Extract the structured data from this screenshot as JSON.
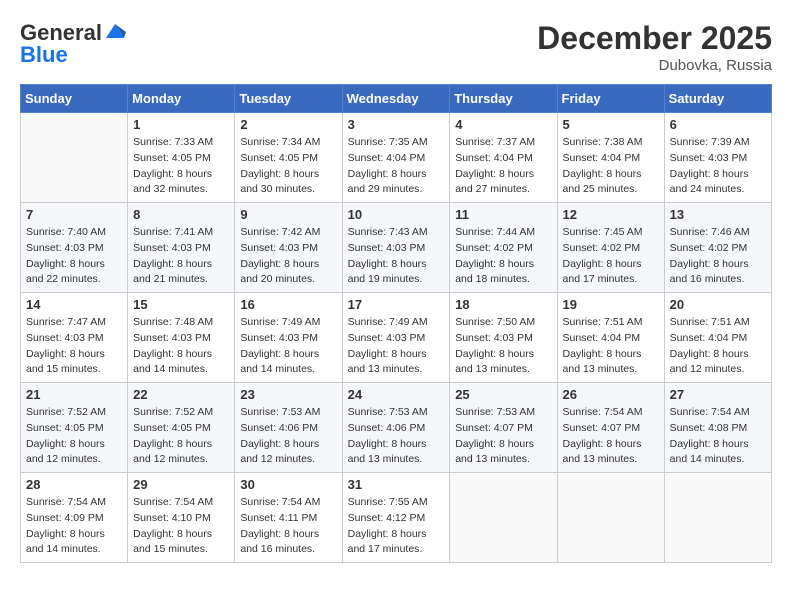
{
  "header": {
    "logo_line1": "General",
    "logo_line2": "Blue",
    "month": "December 2025",
    "location": "Dubovka, Russia"
  },
  "days_of_week": [
    "Sunday",
    "Monday",
    "Tuesday",
    "Wednesday",
    "Thursday",
    "Friday",
    "Saturday"
  ],
  "weeks": [
    [
      {
        "day": "",
        "sunrise": "",
        "sunset": "",
        "daylight": ""
      },
      {
        "day": "1",
        "sunrise": "Sunrise: 7:33 AM",
        "sunset": "Sunset: 4:05 PM",
        "daylight": "Daylight: 8 hours and 32 minutes."
      },
      {
        "day": "2",
        "sunrise": "Sunrise: 7:34 AM",
        "sunset": "Sunset: 4:05 PM",
        "daylight": "Daylight: 8 hours and 30 minutes."
      },
      {
        "day": "3",
        "sunrise": "Sunrise: 7:35 AM",
        "sunset": "Sunset: 4:04 PM",
        "daylight": "Daylight: 8 hours and 29 minutes."
      },
      {
        "day": "4",
        "sunrise": "Sunrise: 7:37 AM",
        "sunset": "Sunset: 4:04 PM",
        "daylight": "Daylight: 8 hours and 27 minutes."
      },
      {
        "day": "5",
        "sunrise": "Sunrise: 7:38 AM",
        "sunset": "Sunset: 4:04 PM",
        "daylight": "Daylight: 8 hours and 25 minutes."
      },
      {
        "day": "6",
        "sunrise": "Sunrise: 7:39 AM",
        "sunset": "Sunset: 4:03 PM",
        "daylight": "Daylight: 8 hours and 24 minutes."
      }
    ],
    [
      {
        "day": "7",
        "sunrise": "Sunrise: 7:40 AM",
        "sunset": "Sunset: 4:03 PM",
        "daylight": "Daylight: 8 hours and 22 minutes."
      },
      {
        "day": "8",
        "sunrise": "Sunrise: 7:41 AM",
        "sunset": "Sunset: 4:03 PM",
        "daylight": "Daylight: 8 hours and 21 minutes."
      },
      {
        "day": "9",
        "sunrise": "Sunrise: 7:42 AM",
        "sunset": "Sunset: 4:03 PM",
        "daylight": "Daylight: 8 hours and 20 minutes."
      },
      {
        "day": "10",
        "sunrise": "Sunrise: 7:43 AM",
        "sunset": "Sunset: 4:03 PM",
        "daylight": "Daylight: 8 hours and 19 minutes."
      },
      {
        "day": "11",
        "sunrise": "Sunrise: 7:44 AM",
        "sunset": "Sunset: 4:02 PM",
        "daylight": "Daylight: 8 hours and 18 minutes."
      },
      {
        "day": "12",
        "sunrise": "Sunrise: 7:45 AM",
        "sunset": "Sunset: 4:02 PM",
        "daylight": "Daylight: 8 hours and 17 minutes."
      },
      {
        "day": "13",
        "sunrise": "Sunrise: 7:46 AM",
        "sunset": "Sunset: 4:02 PM",
        "daylight": "Daylight: 8 hours and 16 minutes."
      }
    ],
    [
      {
        "day": "14",
        "sunrise": "Sunrise: 7:47 AM",
        "sunset": "Sunset: 4:03 PM",
        "daylight": "Daylight: 8 hours and 15 minutes."
      },
      {
        "day": "15",
        "sunrise": "Sunrise: 7:48 AM",
        "sunset": "Sunset: 4:03 PM",
        "daylight": "Daylight: 8 hours and 14 minutes."
      },
      {
        "day": "16",
        "sunrise": "Sunrise: 7:49 AM",
        "sunset": "Sunset: 4:03 PM",
        "daylight": "Daylight: 8 hours and 14 minutes."
      },
      {
        "day": "17",
        "sunrise": "Sunrise: 7:49 AM",
        "sunset": "Sunset: 4:03 PM",
        "daylight": "Daylight: 8 hours and 13 minutes."
      },
      {
        "day": "18",
        "sunrise": "Sunrise: 7:50 AM",
        "sunset": "Sunset: 4:03 PM",
        "daylight": "Daylight: 8 hours and 13 minutes."
      },
      {
        "day": "19",
        "sunrise": "Sunrise: 7:51 AM",
        "sunset": "Sunset: 4:04 PM",
        "daylight": "Daylight: 8 hours and 13 minutes."
      },
      {
        "day": "20",
        "sunrise": "Sunrise: 7:51 AM",
        "sunset": "Sunset: 4:04 PM",
        "daylight": "Daylight: 8 hours and 12 minutes."
      }
    ],
    [
      {
        "day": "21",
        "sunrise": "Sunrise: 7:52 AM",
        "sunset": "Sunset: 4:05 PM",
        "daylight": "Daylight: 8 hours and 12 minutes."
      },
      {
        "day": "22",
        "sunrise": "Sunrise: 7:52 AM",
        "sunset": "Sunset: 4:05 PM",
        "daylight": "Daylight: 8 hours and 12 minutes."
      },
      {
        "day": "23",
        "sunrise": "Sunrise: 7:53 AM",
        "sunset": "Sunset: 4:06 PM",
        "daylight": "Daylight: 8 hours and 12 minutes."
      },
      {
        "day": "24",
        "sunrise": "Sunrise: 7:53 AM",
        "sunset": "Sunset: 4:06 PM",
        "daylight": "Daylight: 8 hours and 13 minutes."
      },
      {
        "day": "25",
        "sunrise": "Sunrise: 7:53 AM",
        "sunset": "Sunset: 4:07 PM",
        "daylight": "Daylight: 8 hours and 13 minutes."
      },
      {
        "day": "26",
        "sunrise": "Sunrise: 7:54 AM",
        "sunset": "Sunset: 4:07 PM",
        "daylight": "Daylight: 8 hours and 13 minutes."
      },
      {
        "day": "27",
        "sunrise": "Sunrise: 7:54 AM",
        "sunset": "Sunset: 4:08 PM",
        "daylight": "Daylight: 8 hours and 14 minutes."
      }
    ],
    [
      {
        "day": "28",
        "sunrise": "Sunrise: 7:54 AM",
        "sunset": "Sunset: 4:09 PM",
        "daylight": "Daylight: 8 hours and 14 minutes."
      },
      {
        "day": "29",
        "sunrise": "Sunrise: 7:54 AM",
        "sunset": "Sunset: 4:10 PM",
        "daylight": "Daylight: 8 hours and 15 minutes."
      },
      {
        "day": "30",
        "sunrise": "Sunrise: 7:54 AM",
        "sunset": "Sunset: 4:11 PM",
        "daylight": "Daylight: 8 hours and 16 minutes."
      },
      {
        "day": "31",
        "sunrise": "Sunrise: 7:55 AM",
        "sunset": "Sunset: 4:12 PM",
        "daylight": "Daylight: 8 hours and 17 minutes."
      },
      {
        "day": "",
        "sunrise": "",
        "sunset": "",
        "daylight": ""
      },
      {
        "day": "",
        "sunrise": "",
        "sunset": "",
        "daylight": ""
      },
      {
        "day": "",
        "sunrise": "",
        "sunset": "",
        "daylight": ""
      }
    ]
  ]
}
